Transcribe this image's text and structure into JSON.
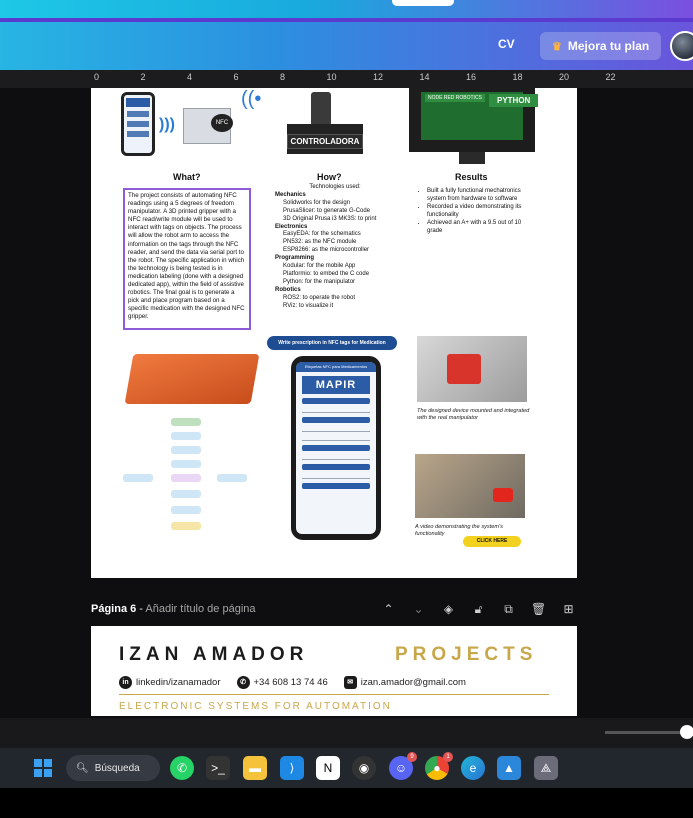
{
  "header": {
    "cv_label": "CV",
    "plan_label": "Mejora tu plan",
    "plan_icon": "crown-icon"
  },
  "ruler": {
    "ticks": [
      "0",
      "2",
      "4",
      "6",
      "8",
      "10",
      "12",
      "14",
      "16",
      "18",
      "20",
      "22"
    ]
  },
  "page5": {
    "controller_label": "CONTROLADORA",
    "python_label": "PYTHON",
    "arduino_label": "NODE RED ROBOTICS",
    "nfc_label": "NFC",
    "what_title": "What?",
    "how_title": "How?",
    "results_title": "Results",
    "what_text": "The project consists of automating NFC readings using a 5 degrees of freedom manipulator. A 3D printed gripper with a NFC read/write module will be used to interact with tags on objects. The process will allow the robot arm to access the information on the tags through the NFC reader, and send the data via serial port to the robot. The specific application in which the technology is being tested is in medication labeling (done with a designed dedicated app), within the field of assistive robotics. The final goal is to generate a pick and place program based on a specific medication with the designed NFC gripper.",
    "how_intro": "Technologies used:",
    "how_sections": [
      {
        "title": "Mechanics",
        "items": [
          "Solidworks for the design",
          "PrusaSlicer: to generate G-Code",
          "3D Original Prusa i3 MK3S: to print"
        ]
      },
      {
        "title": "Electronics",
        "items": [
          "EasyEDA: for the schematics",
          "PN532: as the NFC module",
          "ESP8266: as the microcontroller"
        ]
      },
      {
        "title": "Programming",
        "items": [
          "Kodular: for the mobile App",
          "Platformio: to embed the C code",
          "Python: for the manipulator"
        ]
      },
      {
        "title": "Robotics",
        "items": [
          "ROS2: to operate the robot",
          "RViz: to visualize it"
        ]
      }
    ],
    "results_items": [
      "Built a fully functional mechatronics system from hardware to software",
      "Recorded a video demonstrating its functionality",
      "Achieved an A+ with a 9.5 out of 10 grade"
    ],
    "prescription_label": "Write prescription in NFC tags for Medication",
    "app_title": "Etiquetas NFC para Medicamentos",
    "app_logo": "MAPIR",
    "caption1": "The designed device mounted and integrated with the real manipulator",
    "caption2": "A video demonstrating the system's functionality",
    "click_here": "CLICK HERE"
  },
  "page6_bar": {
    "page_label": "Página 6",
    "separator": " - ",
    "add_title": "Añadir título de página",
    "icons": [
      "chevron-up-icon",
      "chevron-down-icon",
      "eye-icon",
      "lock-icon",
      "duplicate-icon",
      "trash-icon",
      "add-page-icon"
    ]
  },
  "page6": {
    "name": "IZAN AMADOR",
    "projects": "PROJECTS",
    "linkedin": "linkedin/izanamador",
    "phone": "+34 608 13 74 46",
    "email": "izan.amador@gmail.com",
    "tagline": "ELECTRONIC SYSTEMS FOR AUTOMATION"
  },
  "taskbar": {
    "search_label": "Búsqueda",
    "apps": [
      "whatsapp-icon",
      "terminal-icon",
      "file-explorer-icon",
      "vscode-icon",
      "notion-icon",
      "github-icon",
      "discord-icon",
      "chrome-icon",
      "edge-icon",
      "photos-icon",
      "vpn-icon"
    ],
    "discord_badge": "9",
    "chrome_badge": "1"
  },
  "colors": {
    "header_gradient_start": "#27b5e3",
    "header_gradient_end": "#6a55dc",
    "accent_gold": "#c8a64a",
    "accent_purple": "#8e5cd6"
  }
}
